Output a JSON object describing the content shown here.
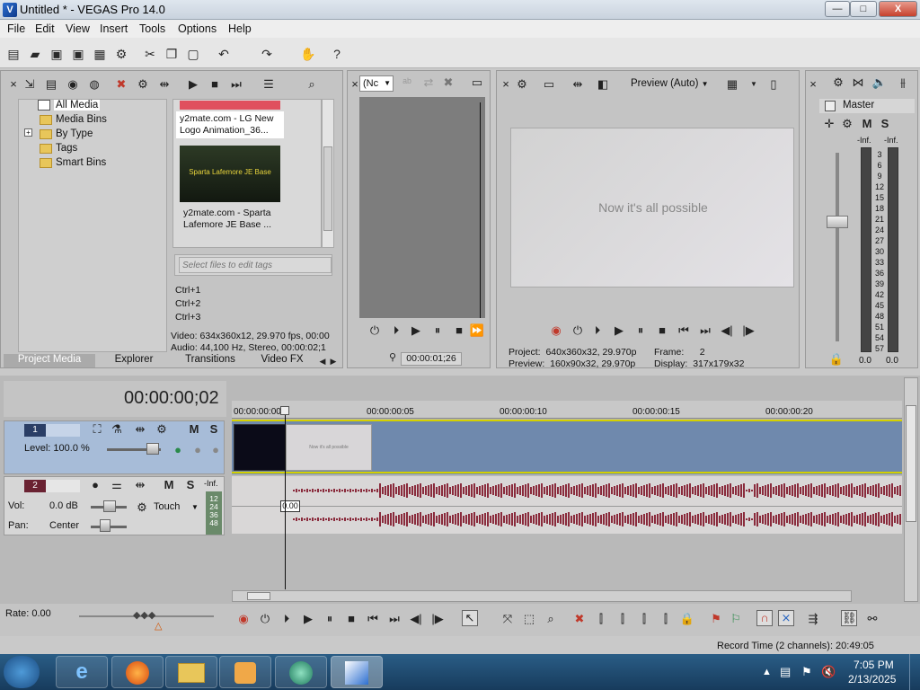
{
  "window": {
    "title": "Untitled * - VEGAS Pro 14.0",
    "app_icon": "vegas-icon"
  },
  "titlebar_buttons": {
    "minimize": "—",
    "maximize": "□",
    "close": "X"
  },
  "menu": [
    "File",
    "Edit",
    "View",
    "Insert",
    "Tools",
    "Options",
    "Help"
  ],
  "media_tree": {
    "items": [
      "All Media",
      "Media Bins",
      "By Type",
      "Tags",
      "Smart Bins"
    ],
    "expander": "+"
  },
  "media_files": [
    {
      "name": "y2mate.com - LG New Logo Animation_36...",
      "thumb_text": ""
    },
    {
      "name": "y2mate.com - Sparta Lafemore JE Base ...",
      "thumb_text": "Sparta Lafemore JE Base"
    }
  ],
  "tags": {
    "placeholder": "Select files to edit tags",
    "shortcuts": [
      "Ctrl+1",
      "Ctrl+2",
      "Ctrl+3"
    ]
  },
  "media_info": {
    "video": "Video: 634x360x12, 29.970 fps, 00:00",
    "audio": "Audio: 44,100 Hz, Stereo, 00:00:02;1"
  },
  "tabs": [
    "Project Media",
    "Explorer",
    "Transitions",
    "Video FX"
  ],
  "trimmer": {
    "dropdown": "(Nc",
    "timecode": "00:00:01;26"
  },
  "preview": {
    "mode": "Preview (Auto)",
    "frame_text": "Now it's all possible",
    "project_label": "Project:",
    "project_value": "640x360x32, 29.970p",
    "preview_label": "Preview:",
    "preview_value": "160x90x32, 29.970p",
    "frame_label": "Frame:",
    "frame_value": "2",
    "display_label": "Display:",
    "display_value": "317x179x32"
  },
  "master": {
    "label": "Master",
    "peak_left": "-Inf.",
    "peak_right": "-Inf.",
    "scale": [
      "3",
      "6",
      "9",
      "12",
      "15",
      "18",
      "21",
      "24",
      "27",
      "30",
      "33",
      "36",
      "39",
      "42",
      "45",
      "48",
      "51",
      "54",
      "57"
    ],
    "value_left": "0.0",
    "value_right": "0.0",
    "m": "M",
    "s": "S"
  },
  "timeline": {
    "timecode": "00:00:00;02",
    "ruler": [
      "00:00:00:00",
      "00:00:00:05",
      "00:00:00:10",
      "00:00:00:15",
      "00:00:00:20"
    ],
    "clip_title": "Now it's all possible",
    "audio_tooltip": "0.00"
  },
  "video_track": {
    "number": "1",
    "level": "Level: 100.0 %",
    "m": "M",
    "s": "S"
  },
  "audio_track": {
    "number": "2",
    "vol": "Vol:",
    "vol_value": "0.0 dB",
    "pan": "Pan:",
    "pan_value": "Center",
    "touch": "Touch",
    "m": "M",
    "s": "S",
    "inf": "-Inf.",
    "meter": [
      "12",
      "24",
      "36",
      "48"
    ]
  },
  "bottom": {
    "rate": "Rate: 0.00",
    "record_time": "Record Time (2 channels): 20:49:05"
  },
  "taskbar": {
    "time": "7:05 PM",
    "date": "2/13/2025"
  },
  "colors": {
    "video_track": "#6f89ad",
    "audio_wave": "#8a2b3c",
    "taskbar": "#1f4a6e"
  }
}
